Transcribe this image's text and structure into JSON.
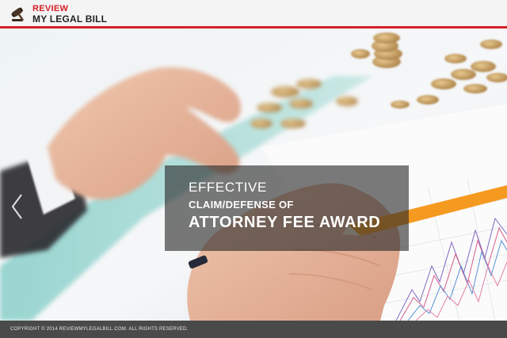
{
  "header": {
    "logo_line1": "REVIEW",
    "logo_line2": "MY LEGAL BILL",
    "logo_icon": "gavel-icon",
    "accent_color": "#d42026"
  },
  "hero": {
    "caption_line1": "EFFECTIVE",
    "caption_line2": "CLAIM/DEFENSE OF",
    "caption_line3": "ATTORNEY FEE AWARD",
    "prev_icon": "chevron-left-icon"
  },
  "footer": {
    "copyright": "COPYRIGHT © 2014  REVIEWMYLEGALBILL.COM.   ALL RIGHTS RESERVED."
  }
}
